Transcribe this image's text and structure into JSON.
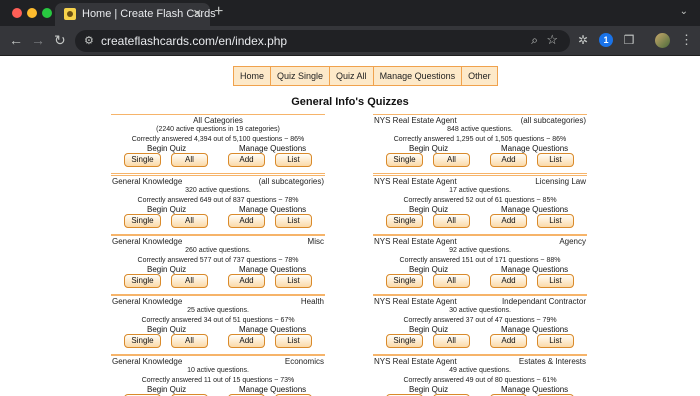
{
  "browser": {
    "tab_title": "Home | Create Flash Cards",
    "tab_close": "✕",
    "new_tab": "+",
    "url": "createflashcards.com/en/index.php"
  },
  "nav": {
    "items": [
      "Home",
      "Quiz Single",
      "Quiz All",
      "Manage Questions",
      "Other"
    ]
  },
  "page_title": "General Info's Quizzes",
  "labels": {
    "begin_quiz": "Begin Quiz",
    "manage_questions": "Manage Questions",
    "single": "Single",
    "all": "All",
    "add": "Add",
    "list": "List"
  },
  "left_cards": [
    {
      "center": "All Categories",
      "line1": "(2240 active questions in 19 categories)",
      "line2": "Correctly answered 4,394 out of 5,100 questions ~ 86%"
    },
    {
      "category": "General Knowledge",
      "sub": "(all subcategories)",
      "line1": "320 active questions.",
      "line2": "Correctly answered 649 out of 837 questions ~ 78%"
    },
    {
      "category": "General Knowledge",
      "sub": "Misc",
      "line1": "260 active questions.",
      "line2": "Correctly answered 577 out of 737 questions ~ 78%"
    },
    {
      "category": "General Knowledge",
      "sub": "Health",
      "line1": "25 active questions.",
      "line2": "Correctly answered 34 out of 51 questions ~ 67%"
    },
    {
      "category": "General Knowledge",
      "sub": "Economics",
      "line1": "10 active questions.",
      "line2": "Correctly answered 11 out of 15 questions ~ 73%"
    }
  ],
  "right_cards": [
    {
      "category": "NYS Real Estate Agent",
      "sub": "(all subcategories)",
      "line1": "848 active questions.",
      "line2": "Correctly answered 1,295 out of 1,505 questions ~ 86%"
    },
    {
      "category": "NYS Real Estate Agent",
      "sub": "Licensing Law",
      "line1": "17 active questions.",
      "line2": "Correctly answered 52 out of 61 questions ~ 85%"
    },
    {
      "category": "NYS Real Estate Agent",
      "sub": "Agency",
      "line1": "92 active questions.",
      "line2": "Correctly answered 151 out of 171 questions ~ 88%"
    },
    {
      "category": "NYS Real Estate Agent",
      "sub": "Independant Contractor",
      "line1": "30 active questions.",
      "line2": "Correctly answered 37 out of 47 questions ~ 79%"
    },
    {
      "category": "NYS Real Estate Agent",
      "sub": "Estates & Interests",
      "line1": "49 active questions.",
      "line2": "Correctly answered 49 out of 80 questions ~ 61%"
    }
  ]
}
